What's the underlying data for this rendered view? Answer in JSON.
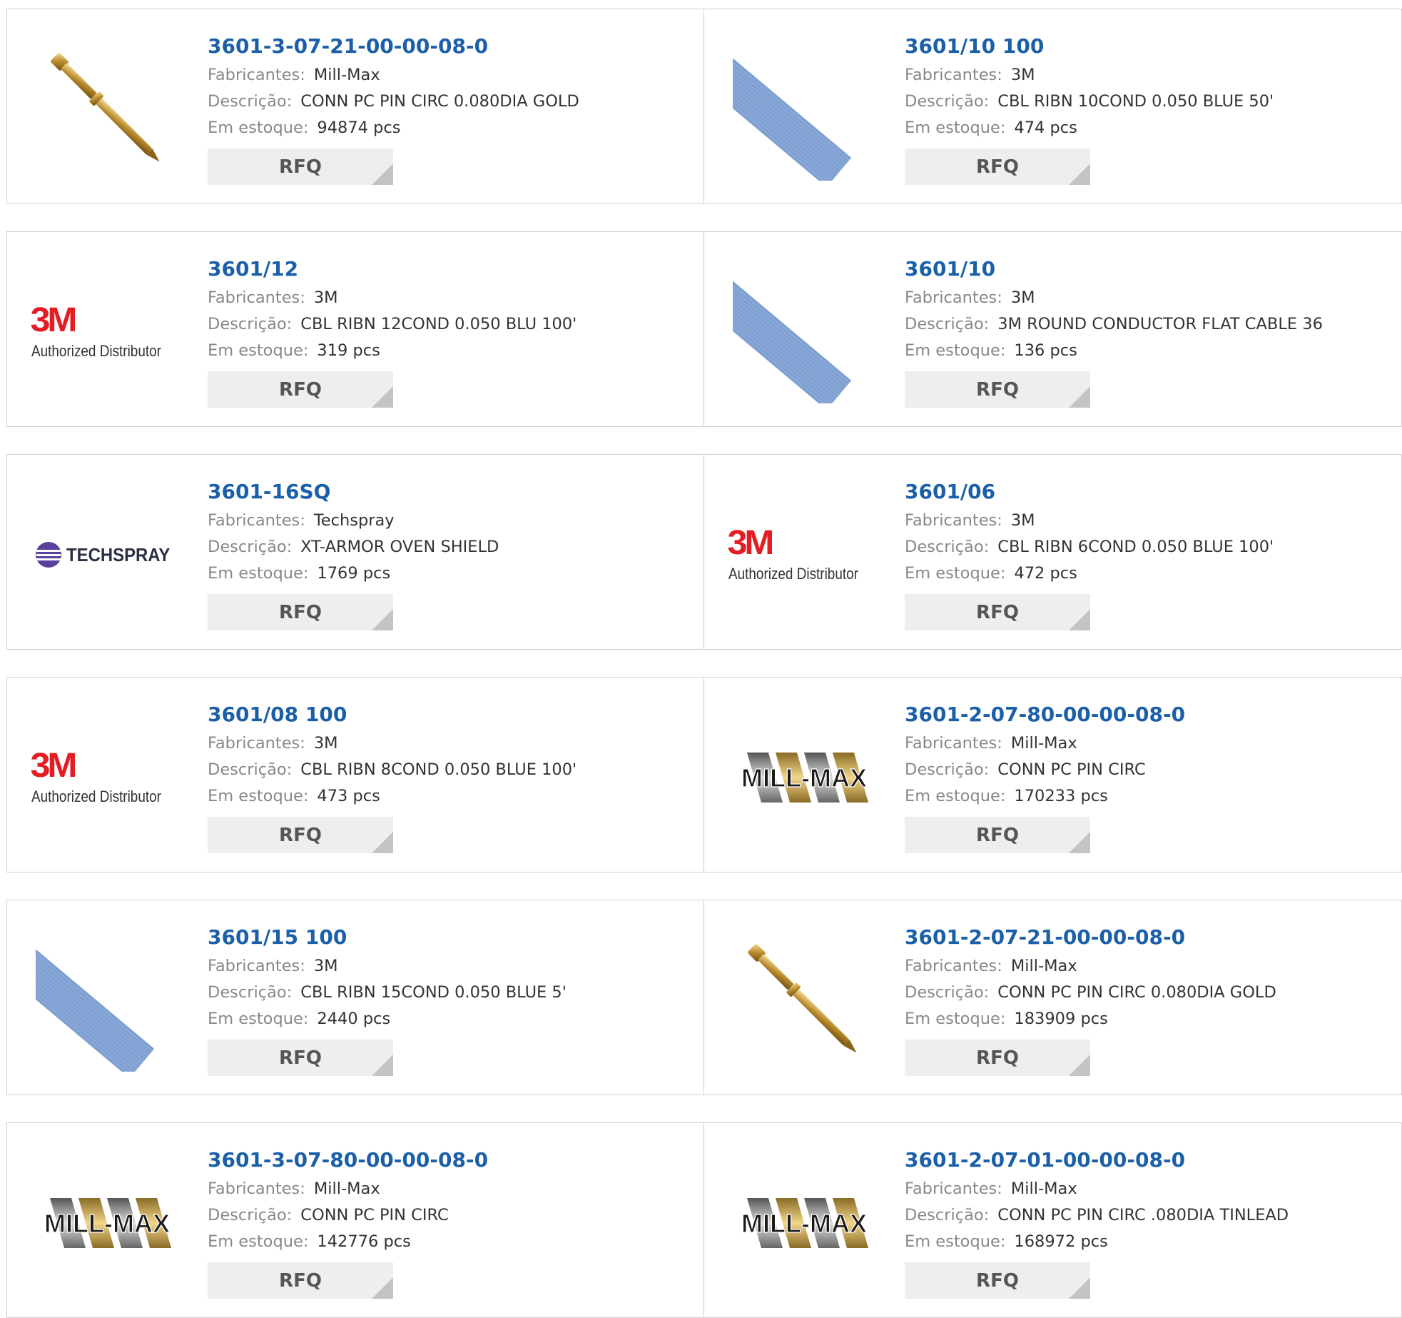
{
  "labels": {
    "manufacturer": "Fabricantes:",
    "description": "Descrição:",
    "stock": "Em estoque:",
    "rfq": "RFQ"
  },
  "brand_logos": {
    "m3_mark": "3M",
    "m3_tagline": "Authorized Distributor",
    "techspray": "TECHSPRAY",
    "millmax": "MILL-MAX"
  },
  "colors": {
    "part_number_link": "#1a5fa8",
    "label_gray": "#888888",
    "button_bg": "#eeeeee",
    "border": "#cfcfcf",
    "brand_3m_red": "#e41c23"
  },
  "products": [
    {
      "part": "3601-3-07-21-00-00-08-0",
      "manufacturer": "Mill-Max",
      "description": "CONN PC PIN CIRC 0.080DIA GOLD",
      "stock": "94874 pcs",
      "image": "gold-pin-icon"
    },
    {
      "part": "3601/10 100",
      "manufacturer": "3M",
      "description": "CBL RIBN 10COND 0.050 BLUE 50'",
      "stock": "474 pcs",
      "image": "ribbon-cable-icon"
    },
    {
      "part": "3601/12",
      "manufacturer": "3M",
      "description": "CBL RIBN 12COND 0.050 BLU 100'",
      "stock": "319 pcs",
      "image": "3m-logo"
    },
    {
      "part": "3601/10",
      "manufacturer": "3M",
      "description": "3M ROUND CONDUCTOR FLAT CABLE 36",
      "stock": "136 pcs",
      "image": "ribbon-cable-icon"
    },
    {
      "part": "3601-16SQ",
      "manufacturer": "Techspray",
      "description": "XT-ARMOR OVEN SHIELD",
      "stock": "1769 pcs",
      "image": "techspray-logo"
    },
    {
      "part": "3601/06",
      "manufacturer": "3M",
      "description": "CBL RIBN 6COND 0.050 BLUE 100'",
      "stock": "472 pcs",
      "image": "3m-logo"
    },
    {
      "part": "3601/08 100",
      "manufacturer": "3M",
      "description": "CBL RIBN 8COND 0.050 BLUE 100'",
      "stock": "473 pcs",
      "image": "3m-logo"
    },
    {
      "part": "3601-2-07-80-00-00-08-0",
      "manufacturer": "Mill-Max",
      "description": "CONN PC PIN CIRC",
      "stock": "170233 pcs",
      "image": "mill-max-logo"
    },
    {
      "part": "3601/15 100",
      "manufacturer": "3M",
      "description": "CBL RIBN 15COND 0.050 BLUE 5'",
      "stock": "2440 pcs",
      "image": "ribbon-cable-icon"
    },
    {
      "part": "3601-2-07-21-00-00-08-0",
      "manufacturer": "Mill-Max",
      "description": "CONN PC PIN CIRC 0.080DIA GOLD",
      "stock": "183909 pcs",
      "image": "gold-pin-icon"
    },
    {
      "part": "3601-3-07-80-00-00-08-0",
      "manufacturer": "Mill-Max",
      "description": "CONN PC PIN CIRC",
      "stock": "142776 pcs",
      "image": "mill-max-logo"
    },
    {
      "part": "3601-2-07-01-00-00-08-0",
      "manufacturer": "Mill-Max",
      "description": "CONN PC PIN CIRC .080DIA TINLEAD",
      "stock": "168972 pcs",
      "image": "mill-max-logo"
    }
  ]
}
